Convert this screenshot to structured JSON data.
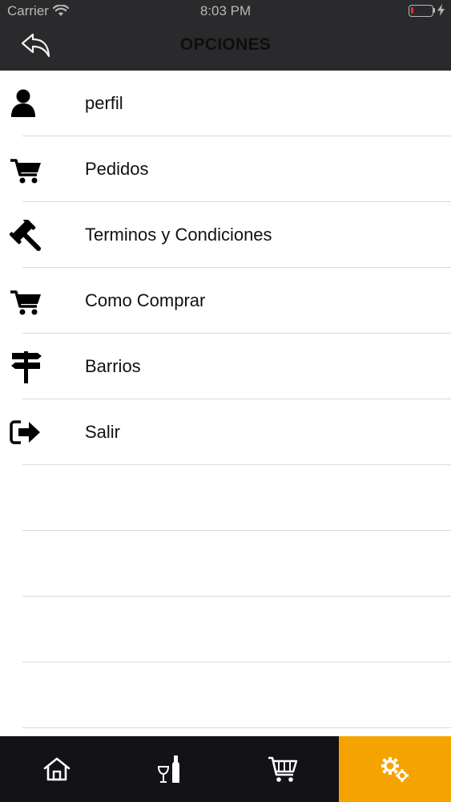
{
  "status_bar": {
    "carrier": "Carrier",
    "time": "8:03 PM",
    "battery_level": 0.1,
    "battery_color": "#e0342c"
  },
  "header": {
    "title": "OPCIONES",
    "back_icon": "back-arrow-icon",
    "background": "#2a2a2c"
  },
  "menu": {
    "items": [
      {
        "label": "perfil",
        "icon": "user-icon"
      },
      {
        "label": "Pedidos",
        "icon": "cart-icon"
      },
      {
        "label": "Terminos y Condiciones",
        "icon": "gavel-icon"
      },
      {
        "label": "Como Comprar",
        "icon": "cart-icon"
      },
      {
        "label": "Barrios",
        "icon": "signpost-icon"
      },
      {
        "label": "Salir",
        "icon": "sign-out-icon"
      }
    ]
  },
  "tab_bar": {
    "tabs": [
      {
        "icon": "home-icon",
        "active": false
      },
      {
        "icon": "wine-bottle-icon",
        "active": false
      },
      {
        "icon": "shopping-cart-icon",
        "active": false
      },
      {
        "icon": "gears-icon",
        "active": true
      }
    ],
    "active_color": "#f5a300",
    "background": "#121217"
  }
}
